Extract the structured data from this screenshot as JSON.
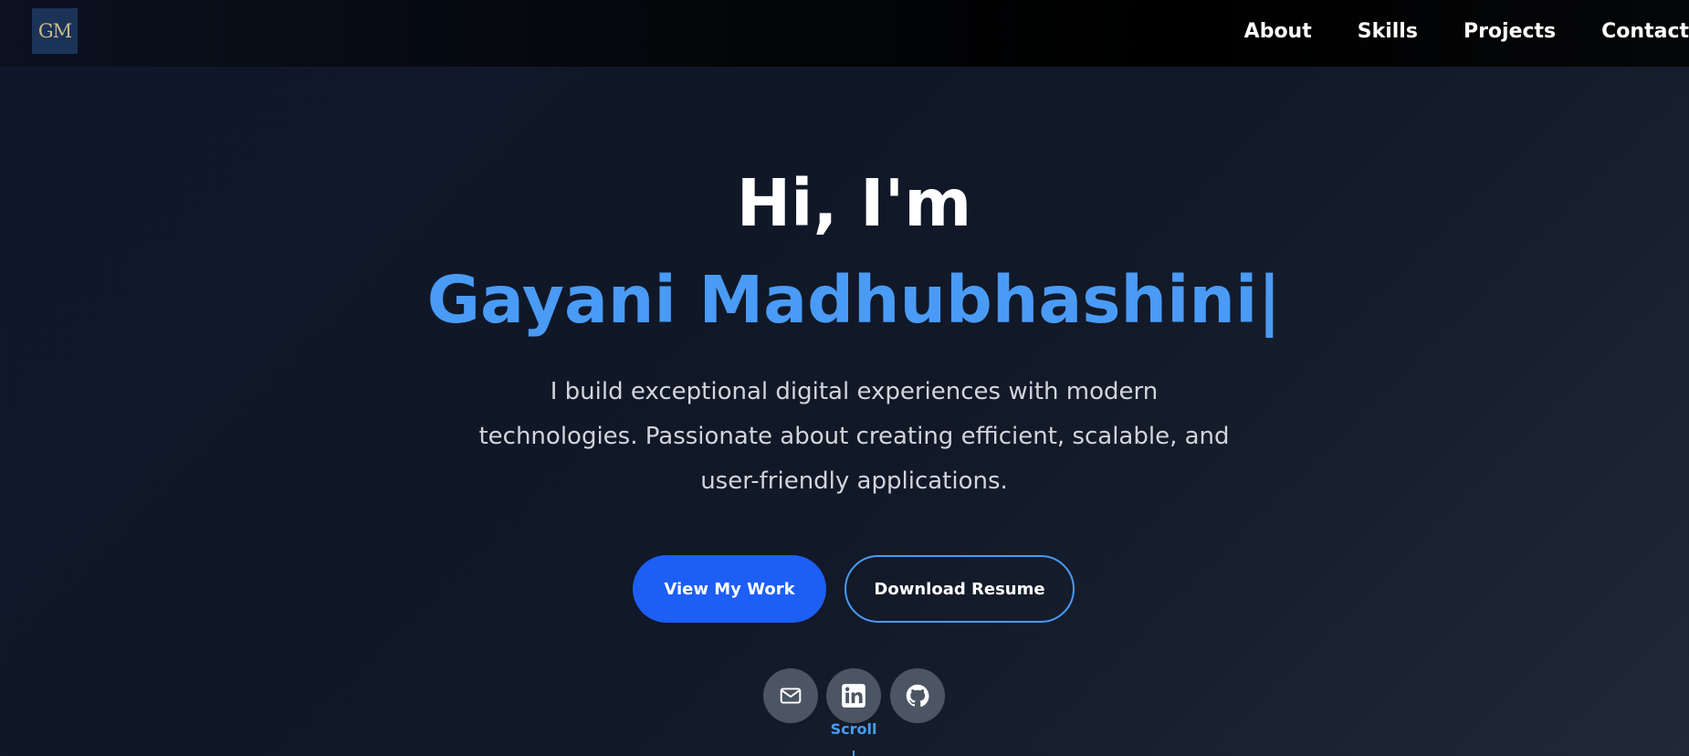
{
  "header": {
    "logo_text": "GM",
    "nav": [
      "About",
      "Skills",
      "Projects",
      "Contact"
    ]
  },
  "hero": {
    "greeting": "Hi, I'm",
    "name": "Gayani Madhubhashini",
    "cursor": "|",
    "tagline": "I build exceptional digital experiences with modern technologies. Passionate about creating efficient, scalable, and user-friendly applications.",
    "primary_button": "View My Work",
    "secondary_button": "Download Resume"
  },
  "social": {
    "icons": [
      "mail-icon",
      "linkedin-icon",
      "github-icon"
    ]
  },
  "scroll": {
    "label": "Scroll"
  },
  "colors": {
    "accent": "#4a9bf5",
    "primary_button": "#1d5ef5",
    "background": "#0f172a",
    "social_button": "#4b5563"
  }
}
